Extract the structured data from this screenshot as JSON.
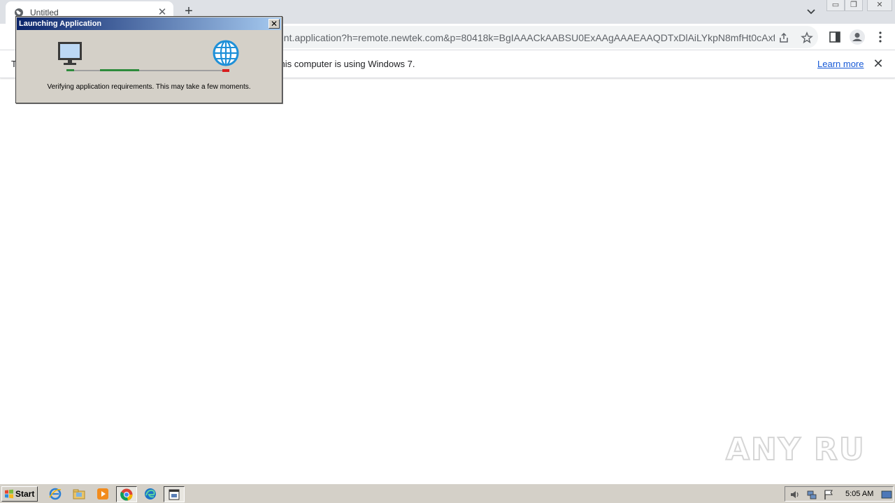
{
  "browser": {
    "tab_title": "Untitled",
    "tab_close": "✕",
    "new_tab": "+",
    "url": "ent.application?h=remote.newtek.com&p=80418k=BgIAAACkAABSU0ExAAgAAAEAAQDTxDlAiLYkpN8mfHt0cAxf...",
    "window_controls": [
      "▭",
      "❐",
      "✕"
    ]
  },
  "infobar": {
    "prefix": "T",
    "message": "r. This computer is using Windows 7.",
    "learn_more": "Learn more",
    "close": "✕"
  },
  "dialog": {
    "title": "Launching Application",
    "close": "✕",
    "message": "Verifying application requirements. This may take a few moments.",
    "progress": 0.25
  },
  "watermark": {
    "text": "ANY RUN"
  },
  "taskbar": {
    "start_label": "Start",
    "clock": "5:05 AM"
  }
}
